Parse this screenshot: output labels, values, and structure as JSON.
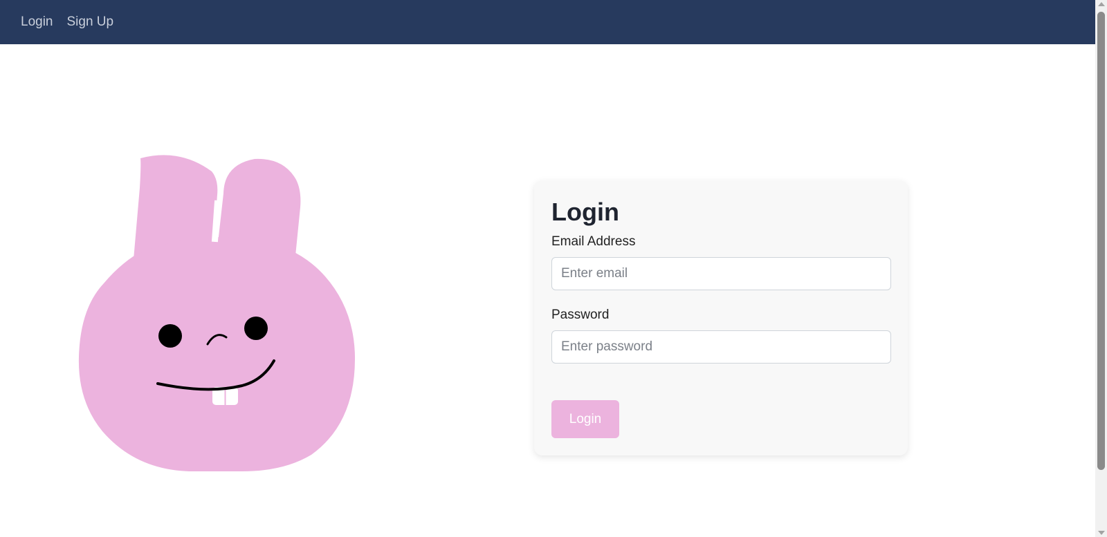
{
  "nav": {
    "links": [
      {
        "label": "Login"
      },
      {
        "label": "Sign Up"
      }
    ]
  },
  "colors": {
    "navbar": "#273a5e",
    "bunny": "#ecb3de",
    "button": "#ecb3de"
  },
  "login_form": {
    "title": "Login",
    "email": {
      "label": "Email Address",
      "placeholder": "Enter email",
      "value": ""
    },
    "password": {
      "label": "Password",
      "placeholder": "Enter password",
      "value": ""
    },
    "submit_label": "Login"
  },
  "illustration": {
    "icon": "bunny-face-illustration"
  }
}
